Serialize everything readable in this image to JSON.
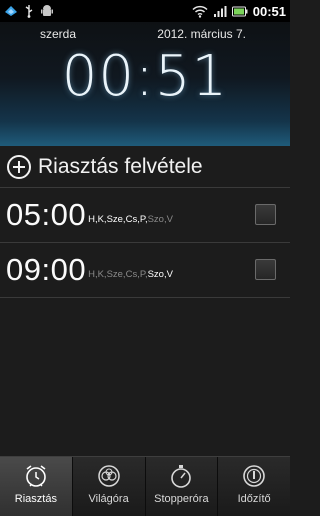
{
  "status_bar": {
    "time": "00:51",
    "icons": [
      "sync-icon",
      "usb-icon",
      "android-debug-icon",
      "wifi-icon",
      "signal-icon",
      "battery-icon"
    ]
  },
  "clock": {
    "day": "szerda",
    "date": "2012. március 7.",
    "time": "00:51"
  },
  "add_alarm": {
    "label": "Riasztás felvétele",
    "icon": "add-circle-icon"
  },
  "alarms": [
    {
      "time": "05:00",
      "days": [
        {
          "text": "H,",
          "active": true
        },
        {
          "text": "K,",
          "active": true
        },
        {
          "text": "Sze,",
          "active": true
        },
        {
          "text": "Cs,",
          "active": true
        },
        {
          "text": "P,",
          "active": true
        },
        {
          "text": "Szo,",
          "active": false
        },
        {
          "text": "V",
          "active": false
        }
      ],
      "enabled": false
    },
    {
      "time": "09:00",
      "days": [
        {
          "text": "H,",
          "active": false
        },
        {
          "text": "K,",
          "active": false
        },
        {
          "text": "Sze,",
          "active": false
        },
        {
          "text": "Cs,",
          "active": false
        },
        {
          "text": "P,",
          "active": false
        },
        {
          "text": "Szo,",
          "active": true
        },
        {
          "text": "V",
          "active": true
        }
      ],
      "enabled": false
    }
  ],
  "tabs": [
    {
      "label": "Riasztás",
      "icon": "alarm-clock-icon",
      "active": true
    },
    {
      "label": "Világóra",
      "icon": "world-clock-icon",
      "active": false
    },
    {
      "label": "Stopperóra",
      "icon": "stopwatch-icon",
      "active": false
    },
    {
      "label": "Időzítő",
      "icon": "timer-icon",
      "active": false
    }
  ],
  "colors": {
    "active_day": "#ffffff",
    "inactive_day": "#8a8a8a",
    "clock_glow": "#8cc8f0"
  }
}
